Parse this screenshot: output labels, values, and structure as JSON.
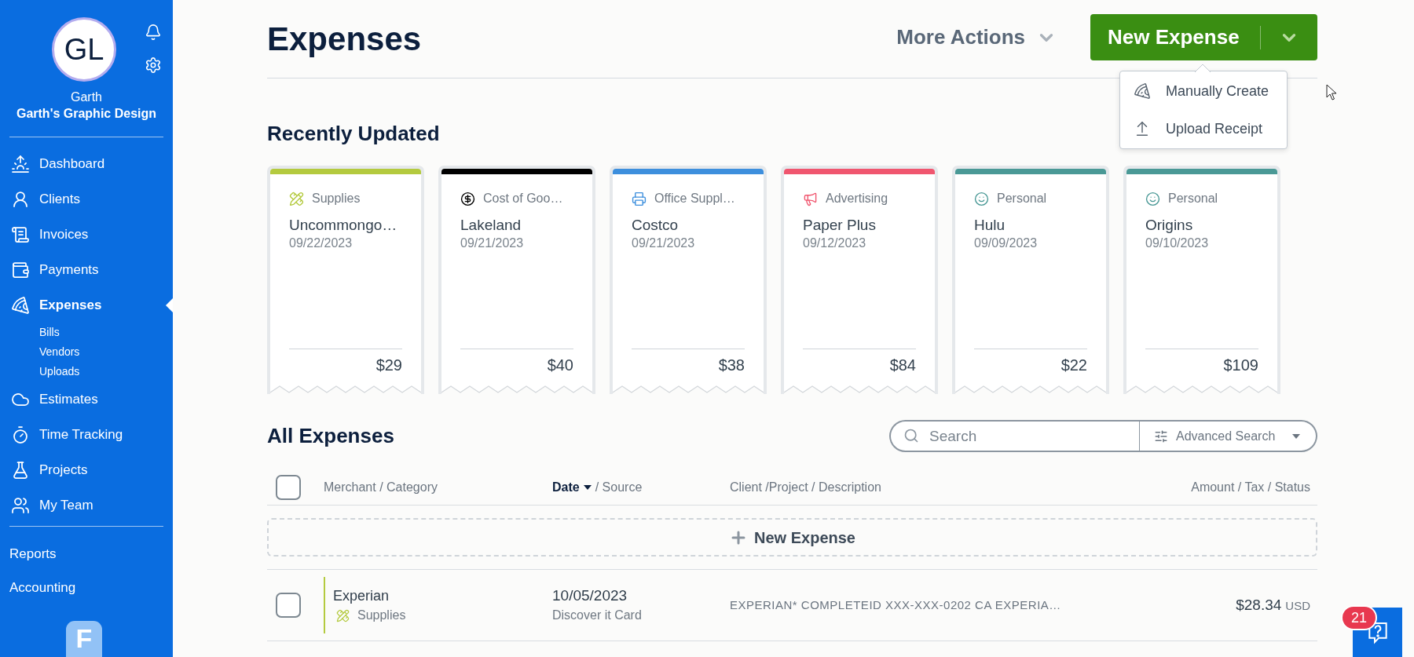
{
  "sidebar": {
    "avatar": {
      "initials": "GL"
    },
    "user_name": "Garth",
    "company": "Garth's Graphic Design",
    "nav": [
      {
        "label": "Dashboard",
        "selected": false
      },
      {
        "label": "Clients",
        "selected": false
      },
      {
        "label": "Invoices",
        "selected": false
      },
      {
        "label": "Payments",
        "selected": false
      },
      {
        "label": "Expenses",
        "selected": true,
        "children": [
          {
            "label": "Bills",
            "selected": false
          },
          {
            "label": "Vendors",
            "selected": false
          },
          {
            "label": "Uploads",
            "selected": false
          }
        ]
      },
      {
        "label": "Estimates",
        "selected": false
      },
      {
        "label": "Time Tracking",
        "selected": false
      },
      {
        "label": "Projects",
        "selected": false
      },
      {
        "label": "My Team",
        "selected": false
      }
    ],
    "secondary_nav": [
      {
        "label": "Reports",
        "selected": false
      },
      {
        "label": "Accounting",
        "selected": false
      }
    ],
    "logo": {
      "letter": "F"
    }
  },
  "header": {
    "title": "Expenses",
    "more_actions": "More Actions",
    "new_expense_button": {
      "label": "New Expense",
      "expanded": true,
      "menu": [
        {
          "label": "Manually Create"
        },
        {
          "label": "Upload Receipt"
        }
      ]
    }
  },
  "recently_updated": {
    "title": "Recently Updated",
    "cards": [
      {
        "category": "Supplies",
        "merchant": "Uncommongo…",
        "date": "09/22/2023",
        "amount": "$29",
        "color": "#b4ca3f"
      },
      {
        "category": "Cost of Goo…",
        "merchant": "Lakeland",
        "date": "09/21/2023",
        "amount": "$40",
        "color": "#000000"
      },
      {
        "category": "Office Suppl…",
        "merchant": "Costco",
        "date": "09/21/2023",
        "amount": "$38",
        "color": "#3d8fdd"
      },
      {
        "category": "Advertising",
        "merchant": "Paper Plus",
        "date": "09/12/2023",
        "amount": "$84",
        "color": "#f0566f"
      },
      {
        "category": "Personal",
        "merchant": "Hulu",
        "date": "09/09/2023",
        "amount": "$22",
        "color": "#4a9996"
      },
      {
        "category": "Personal",
        "merchant": "Origins",
        "date": "09/10/2023",
        "amount": "$109",
        "color": "#4a9996"
      }
    ]
  },
  "all_expenses": {
    "title": "All Expenses",
    "search": {
      "placeholder": "Search"
    },
    "advanced_search": "Advanced Search",
    "select_all": {
      "checked": false
    },
    "columns": [
      {
        "label": "Merchant / Category",
        "sorted": false
      },
      {
        "label": "Date",
        "sub": "/ Source",
        "sorted": true
      },
      {
        "label": "Client /Project / Description",
        "sorted": false
      },
      {
        "label": "Amount / Tax / Status",
        "sorted": false
      }
    ],
    "new_expense_row": "New Expense",
    "rows": [
      {
        "merchant": "Experian",
        "category": "Supplies",
        "color": "#b4ca3f",
        "date": "10/05/2023",
        "source": "Discover it Card",
        "description": "EXPERIAN* COMPLETEID XXX-XXX-0202 CA EXPERIA…",
        "amount": "$28.34",
        "currency": "USD",
        "checked": false
      }
    ]
  },
  "help": {
    "badge": "21"
  }
}
